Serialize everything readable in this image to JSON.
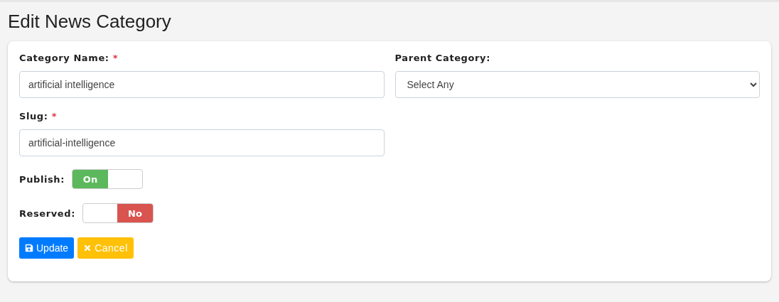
{
  "page_title": "Edit News Category",
  "category_name": {
    "label": "Category Name:",
    "required_mark": "*",
    "value": "artificial intelligence"
  },
  "parent_category": {
    "label": "Parent Category:",
    "value": "Select Any"
  },
  "slug": {
    "label": "Slug:",
    "required_mark": "*",
    "value": "artificial-intelligence"
  },
  "toggles": [
    {
      "label": "Publish:",
      "on": true,
      "text": "On"
    },
    {
      "label": "Reserved:",
      "on": false,
      "text": "No"
    }
  ],
  "buttons": [
    {
      "kind": "primary",
      "label": "Update"
    },
    {
      "kind": "warning",
      "label": "Cancel"
    }
  ]
}
